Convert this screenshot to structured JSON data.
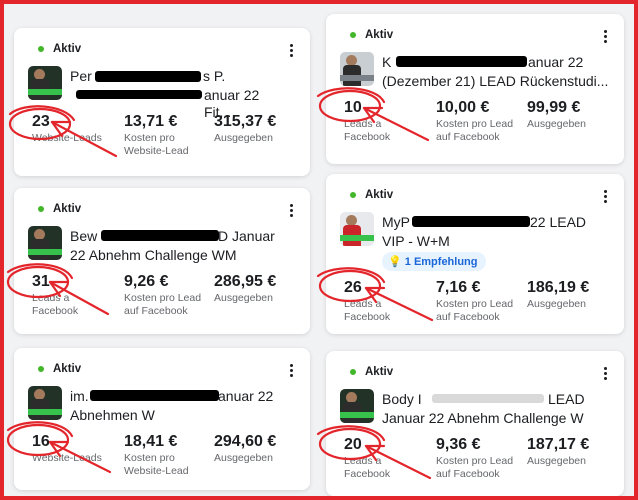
{
  "accent": "#e3262c",
  "status_dot_color": "#42b72a",
  "cards": [
    {
      "status": "Aktiv",
      "icon": "more-options-icon",
      "title_lines": [
        "Per",
        "",
        "s P.",
        "",
        "anuar 22 Fit..."
      ],
      "metrics": [
        {
          "value": "23",
          "label_a": "Website-",
          "label_b": "Leads",
          "label_c": ""
        },
        {
          "value": "13,71 €",
          "label_a": "Kosten pro",
          "label_b": "Website-Lead",
          "label_c": ""
        },
        {
          "value": "315,37 €",
          "label_a": "Ausgegeben",
          "label_b": "",
          "label_c": ""
        }
      ]
    },
    {
      "status": "Aktiv",
      "icon": "more-options-icon",
      "title_lines": [
        "K",
        "anuar 22",
        "(Dezember 21) LEAD Rückenstudi..."
      ],
      "metrics": [
        {
          "value": "10",
          "label_a": "Leads a",
          "label_b": "Facebook",
          "label_c": ""
        },
        {
          "value": "10,00 €",
          "label_a": "Kosten pro Lead",
          "label_b": "auf Facebook",
          "label_c": ""
        },
        {
          "value": "99,99 €",
          "label_a": "Ausgegeben",
          "label_b": "",
          "label_c": ""
        }
      ]
    },
    {
      "status": "Aktiv",
      "icon": "more-options-icon",
      "title_lines": [
        "Bew",
        "D Januar",
        "22 Abnehm Challenge WM"
      ],
      "metrics": [
        {
          "value": "31",
          "label_a": "Leads a",
          "label_b": "Facebook",
          "label_c": ""
        },
        {
          "value": "9,26 €",
          "label_a": "Kosten pro Lead",
          "label_b": "auf Facebook",
          "label_c": ""
        },
        {
          "value": "286,95 €",
          "label_a": "Ausgegeben",
          "label_b": "",
          "label_c": ""
        }
      ]
    },
    {
      "status": "Aktiv",
      "icon": "more-options-icon",
      "title_lines": [
        "MyP",
        "22 LEAD",
        "VIP - W+M"
      ],
      "badge": "1 Empfehlung",
      "metrics": [
        {
          "value": "26",
          "label_a": "Leads a",
          "label_b": "Facebook",
          "label_c": ""
        },
        {
          "value": "7,16 €",
          "label_a": "Kosten pro Lead",
          "label_b": "auf Facebook",
          "label_c": ""
        },
        {
          "value": "186,19 €",
          "label_a": "Ausgegeben",
          "label_b": "",
          "label_c": ""
        }
      ]
    },
    {
      "status": "Aktiv",
      "icon": "more-options-icon",
      "title_lines": [
        "im.",
        "anuar 22",
        "Abnehmen W"
      ],
      "metrics": [
        {
          "value": "16",
          "label_a": "Website-",
          "label_b": "Leads",
          "label_c": ""
        },
        {
          "value": "18,41 €",
          "label_a": "Kosten pro",
          "label_b": "Website-Lead",
          "label_c": ""
        },
        {
          "value": "294,60 €",
          "label_a": "Ausgegeben",
          "label_b": "",
          "label_c": ""
        }
      ]
    },
    {
      "status": "Aktiv",
      "icon": "more-options-icon",
      "title_lines": [
        "Body I",
        "LEAD",
        "Januar 22 Abnehm Challenge W"
      ],
      "metrics": [
        {
          "value": "20",
          "label_a": "Leads a",
          "label_b": "Facebook",
          "label_c": ""
        },
        {
          "value": "9,36 €",
          "label_a": "Kosten pro Lead",
          "label_b": "auf Facebook",
          "label_c": ""
        },
        {
          "value": "187,17 €",
          "label_a": "Ausgegeben",
          "label_b": "",
          "label_c": ""
        }
      ]
    }
  ]
}
